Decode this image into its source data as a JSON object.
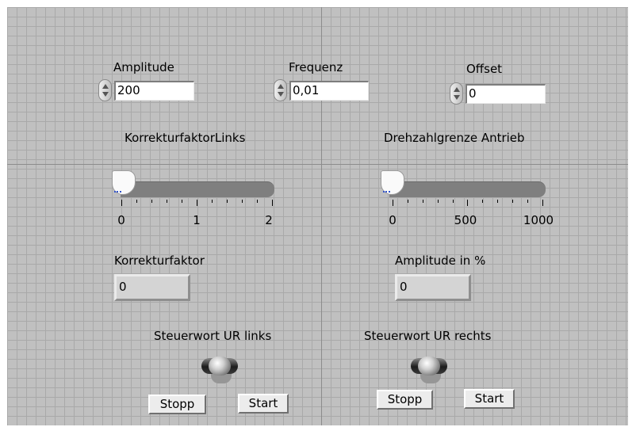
{
  "controls": {
    "amplitude": {
      "label": "Amplitude",
      "value": "200"
    },
    "frequenz": {
      "label": "Frequenz",
      "value": "0,01"
    },
    "offset": {
      "label": "Offset",
      "value": "0"
    }
  },
  "sliders": {
    "korrektur": {
      "label": "KorrekturfaktorLinks",
      "ticks": [
        "0",
        "1",
        "2"
      ],
      "value": 0
    },
    "drehzahl": {
      "label": "Drehzahlgrenze Antrieb",
      "ticks": [
        "0",
        "500",
        "1000"
      ],
      "value": 0
    }
  },
  "indicators": {
    "korrekturfaktor": {
      "label": "Korrekturfaktor",
      "value": "0"
    },
    "amplitude_pct": {
      "label": "Amplitude in %",
      "value": "0"
    }
  },
  "switches": {
    "links": {
      "label": "Steuerwort UR links",
      "stopp": "Stopp",
      "start": "Start"
    },
    "rechts": {
      "label": "Steuerwort UR rechts",
      "stopp": "Stopp",
      "start": "Start"
    }
  },
  "colors": {
    "panel": "#c0c0c0",
    "grid": "#a9a9a9"
  }
}
